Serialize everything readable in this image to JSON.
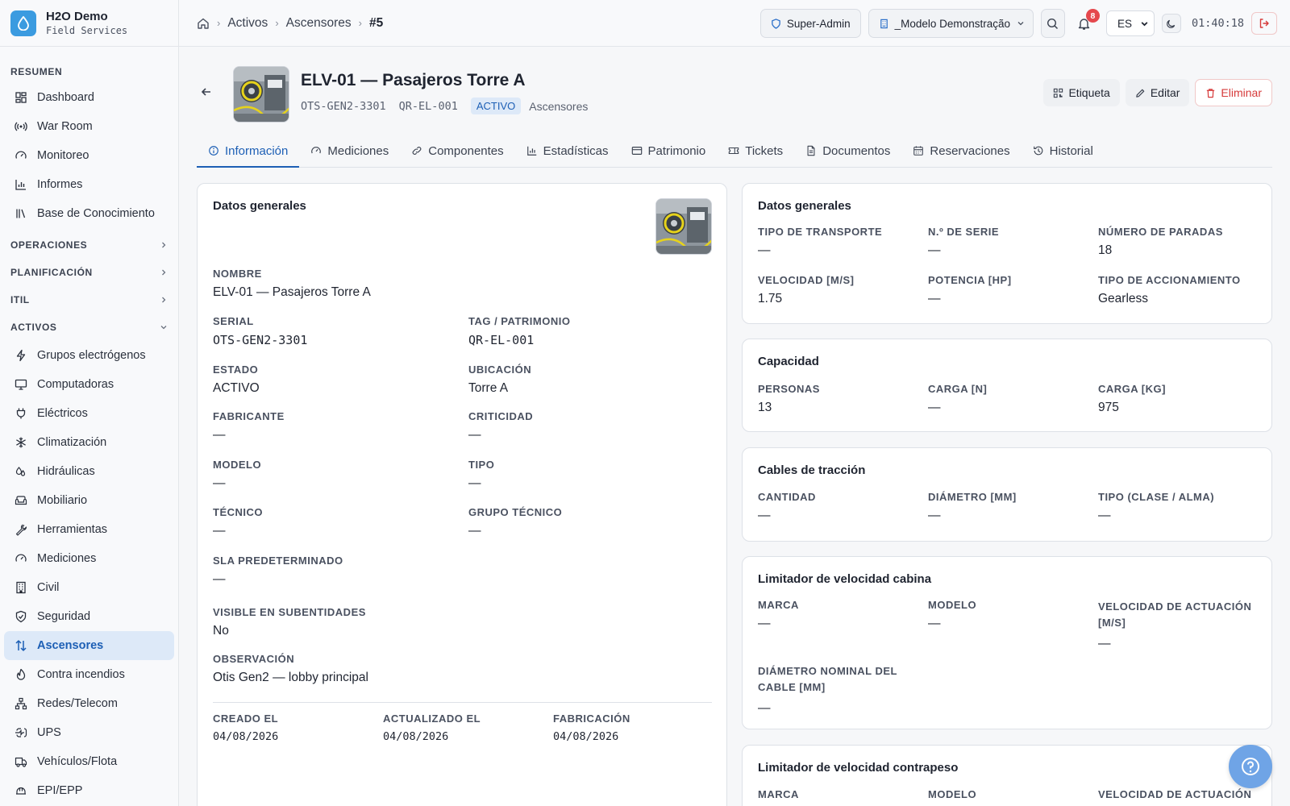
{
  "brand": {
    "name": "H2O Demo",
    "subtitle": "Field Services",
    "accent": "#3b9be0"
  },
  "sidebar": {
    "resumen_label": "RESUMEN",
    "resumen": [
      {
        "label": "Dashboard",
        "icon": "dashboard-icon"
      },
      {
        "label": "War Room",
        "icon": "broadcast-icon"
      },
      {
        "label": "Monitoreo",
        "icon": "gauge-icon"
      },
      {
        "label": "Informes",
        "icon": "bar-chart-icon"
      },
      {
        "label": "Base de Conocimiento",
        "icon": "library-icon"
      }
    ],
    "sections": [
      {
        "label": "OPERACIONES"
      },
      {
        "label": "PLANIFICACIÓN"
      },
      {
        "label": "ITIL"
      }
    ],
    "activos_label": "ACTIVOS",
    "activos": [
      {
        "label": "Grupos electrógenos",
        "icon": "zap-icon"
      },
      {
        "label": "Computadoras",
        "icon": "monitor-icon"
      },
      {
        "label": "Eléctricos",
        "icon": "plug-icon"
      },
      {
        "label": "Climatización",
        "icon": "snowflake-icon"
      },
      {
        "label": "Hidráulicas",
        "icon": "droplets-icon"
      },
      {
        "label": "Mobiliario",
        "icon": "sofa-icon"
      },
      {
        "label": "Herramientas",
        "icon": "wrench-icon"
      },
      {
        "label": "Mediciones",
        "icon": "gauge-icon"
      },
      {
        "label": "Civil",
        "icon": "building-icon"
      },
      {
        "label": "Seguridad",
        "icon": "shield-icon"
      },
      {
        "label": "Ascensores",
        "icon": "arrow-up-down-icon",
        "active": true
      },
      {
        "label": "Contra incendios",
        "icon": "flame-icon"
      },
      {
        "label": "Redes/Telecom",
        "icon": "network-icon"
      },
      {
        "label": "UPS",
        "icon": "battery-icon"
      },
      {
        "label": "Vehículos/Flota",
        "icon": "truck-icon"
      },
      {
        "label": "EPI/EPP",
        "icon": "hardhat-icon"
      }
    ]
  },
  "breadcrumb": {
    "home_icon": "home-icon",
    "items": [
      "Activos",
      "Ascensores"
    ],
    "current": "#5"
  },
  "topbar": {
    "role": "Super-Admin",
    "tenant": "_Modelo Demonstração",
    "notifications": "8",
    "language": "ES",
    "clock": "01:40:18"
  },
  "asset": {
    "title": "ELV-01 — Pasajeros Torre A",
    "serial": "OTS-GEN2-3301",
    "tag": "QR-EL-001",
    "status": "ACTIVO",
    "category": "Ascensores"
  },
  "actions": {
    "label": "Etiqueta",
    "edit": "Editar",
    "delete": "Eliminar"
  },
  "tabs": [
    {
      "label": "Información",
      "icon": "info-icon",
      "active": true
    },
    {
      "label": "Mediciones",
      "icon": "gauge-icon"
    },
    {
      "label": "Componentes",
      "icon": "link-icon"
    },
    {
      "label": "Estadísticas",
      "icon": "bar-chart-icon"
    },
    {
      "label": "Patrimonio",
      "icon": "credit-card-icon"
    },
    {
      "label": "Tickets",
      "icon": "ticket-icon"
    },
    {
      "label": "Documentos",
      "icon": "file-icon"
    },
    {
      "label": "Reservaciones",
      "icon": "calendar-icon"
    },
    {
      "label": "Historial",
      "icon": "history-icon"
    }
  ],
  "general": {
    "title": "Datos generales",
    "nombre_label": "NOMBRE",
    "nombre": "ELV-01 — Pasajeros Torre A",
    "serial_label": "SERIAL",
    "serial": "OTS-GEN2-3301",
    "tag_label": "TAG / PATRIMONIO",
    "tag": "QR-EL-001",
    "estado_label": "ESTADO",
    "estado": "ACTIVO",
    "ubicacion_label": "UBICACIÓN",
    "ubicacion": "Torre A",
    "fabricante_label": "FABRICANTE",
    "fabricante": "—",
    "criticidad_label": "CRITICIDAD",
    "criticidad": "—",
    "modelo_label": "MODELO",
    "modelo": "—",
    "tipo_label": "TIPO",
    "tipo": "—",
    "tecnico_label": "TÉCNICO",
    "tecnico": "—",
    "grupo_label": "GRUPO TÉCNICO",
    "grupo": "—",
    "sla_label": "SLA PREDETERMINADO",
    "sla": "—",
    "visible_label": "VISIBLE EN SUBENTIDADES",
    "visible": "No",
    "obs_label": "OBSERVACIÓN",
    "obs": "Otis Gen2 — lobby principal",
    "creado_label": "CREADO EL",
    "creado": "04/08/2026",
    "actualizado_label": "ACTUALIZADO EL",
    "actualizado": "04/08/2026",
    "fabricacion_label": "FABRICACIÓN",
    "fabricacion": "04/08/2026"
  },
  "specs": {
    "title": "Datos generales",
    "transporte_label": "TIPO DE TRANSPORTE",
    "transporte": "—",
    "serie_label": "N.º DE SERIE",
    "serie": "—",
    "paradas_label": "NÚMERO DE PARADAS",
    "paradas": "18",
    "velocidad_label": "VELOCIDAD [M/S]",
    "velocidad": "1.75",
    "potencia_label": "POTENCIA [HP]",
    "potencia": "—",
    "accionamiento_label": "TIPO DE ACCIONAMIENTO",
    "accionamiento": "Gearless"
  },
  "capacidad": {
    "title": "Capacidad",
    "personas_label": "PERSONAS",
    "personas": "13",
    "carga_n_label": "CARGA [N]",
    "carga_n": "—",
    "carga_kg_label": "CARGA [KG]",
    "carga_kg": "975"
  },
  "cables": {
    "title": "Cables de tracción",
    "cantidad_label": "CANTIDAD",
    "cantidad": "—",
    "diametro_label": "DIÁMETRO [MM]",
    "diametro": "—",
    "tipo_label": "TIPO (CLASE / ALMA)",
    "tipo": "—"
  },
  "limitador_cabina": {
    "title": "Limitador de velocidad cabina",
    "marca_label": "MARCA",
    "marca": "—",
    "modelo_label": "MODELO",
    "modelo": "—",
    "actuacion_label": "VELOCIDAD DE ACTUACIÓN [M/S]",
    "actuacion": "—",
    "diametro_label": "DIÁMETRO NOMINAL DEL CABLE [MM]",
    "diametro": "—"
  },
  "limitador_contrapeso": {
    "title": "Limitador de velocidad contrapeso",
    "marca_label": "MARCA",
    "modelo_label": "MODELO",
    "actuacion_label": "VELOCIDAD DE ACTUACIÓN"
  }
}
